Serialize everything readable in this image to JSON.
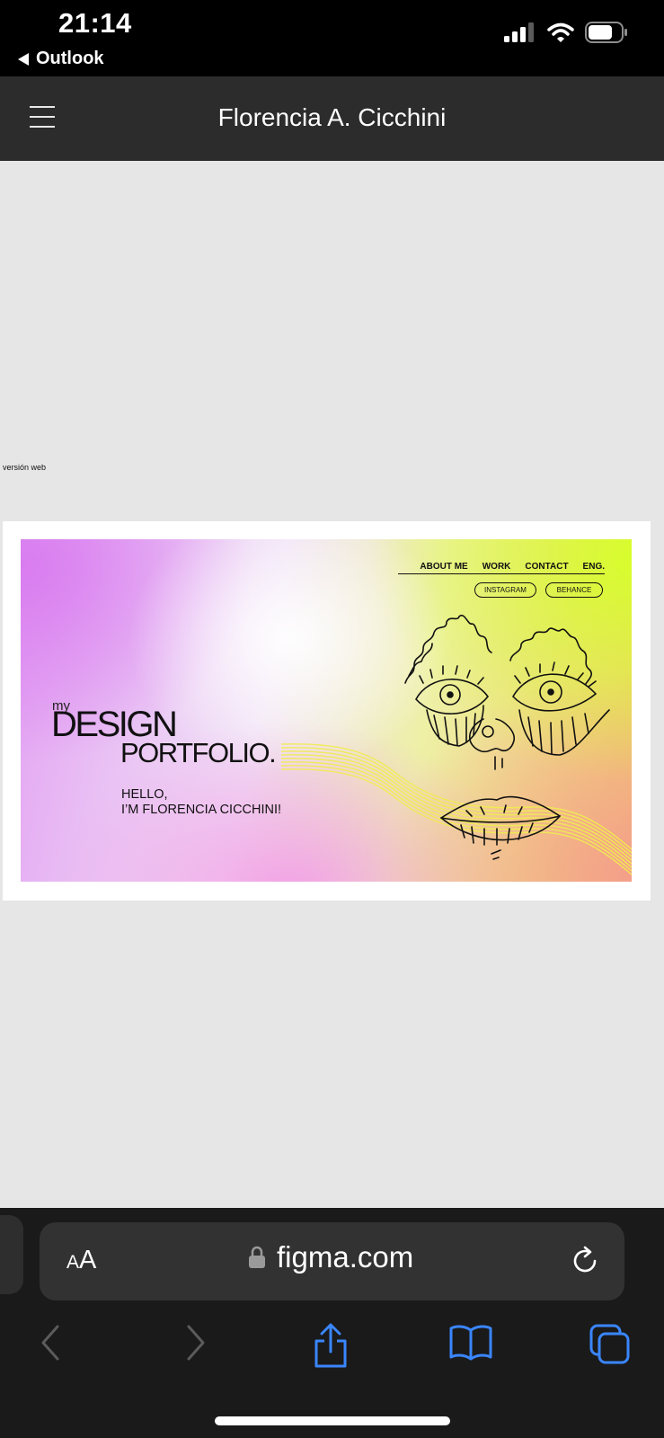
{
  "status_bar": {
    "time": "21:14",
    "back_app": "Outlook",
    "icons": [
      "cellular-signal-icon",
      "wifi-icon",
      "battery-icon"
    ]
  },
  "header": {
    "title": "Florencia A. Cicchini",
    "menu_icon": "hamburger-menu-icon"
  },
  "canvas": {
    "frame_label": "versión web",
    "artboard": {
      "nav_links": [
        "ABOUT ME",
        "WORK",
        "CONTACT",
        "ENG."
      ],
      "social_links": [
        "INSTAGRAM",
        "BEHANCE"
      ],
      "title_my": "my",
      "title_design": "DESIGN",
      "title_portfolio": "PORTFOLIO.",
      "greeting_line1": "HELLO,",
      "greeting_line2": "I’M FLORENCIA CICCHINI!",
      "illustration": "face-line-drawing",
      "colors": {
        "purple": "#d97cf0",
        "lime": "#d6ff2a",
        "coral": "#f49c8c",
        "wave": "#f2ef5a"
      }
    }
  },
  "browser": {
    "text_size_button": "AA",
    "url": "figma.com",
    "icons": [
      "lock-icon",
      "reload-icon",
      "back-icon",
      "forward-icon",
      "share-icon",
      "bookmarks-icon",
      "tabs-icon"
    ],
    "accent": "#3a86ff"
  }
}
